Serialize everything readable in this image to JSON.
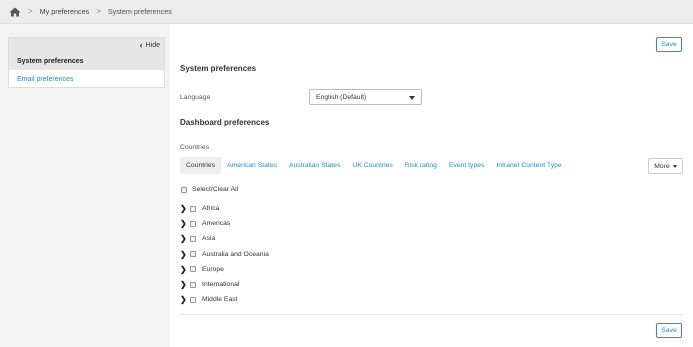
{
  "breadcrumb": {
    "home_icon": "home-icon",
    "items": [
      {
        "label": "My preferences"
      },
      {
        "label": "System preferences"
      }
    ]
  },
  "sidebar": {
    "hide_label": "Hide",
    "active_item": "System preferences",
    "items": [
      {
        "label": "Email preferences"
      }
    ]
  },
  "main": {
    "save_label": "Save",
    "system_heading": "System preferences",
    "language": {
      "label": "Language",
      "value": "English (Default)"
    },
    "dashboard_heading": "Dashboard preferences",
    "countries_label": "Countries",
    "tabs": [
      {
        "label": "Countries",
        "active": true
      },
      {
        "label": "American States"
      },
      {
        "label": "Australian States"
      },
      {
        "label": "UK Countries"
      },
      {
        "label": "Risk rating"
      },
      {
        "label": "Event types"
      },
      {
        "label": "Intranet Content Type"
      }
    ],
    "more_label": "More",
    "select_all_label": "Select/Clear All",
    "regions": [
      {
        "label": "Africa"
      },
      {
        "label": "Americas"
      },
      {
        "label": "Asia"
      },
      {
        "label": "Australia and Oceania"
      },
      {
        "label": "Europe"
      },
      {
        "label": "International"
      },
      {
        "label": "Middle East"
      }
    ]
  },
  "colors": {
    "accent": "#2a8bd6",
    "sidebar_active": "#e6e6e6"
  }
}
